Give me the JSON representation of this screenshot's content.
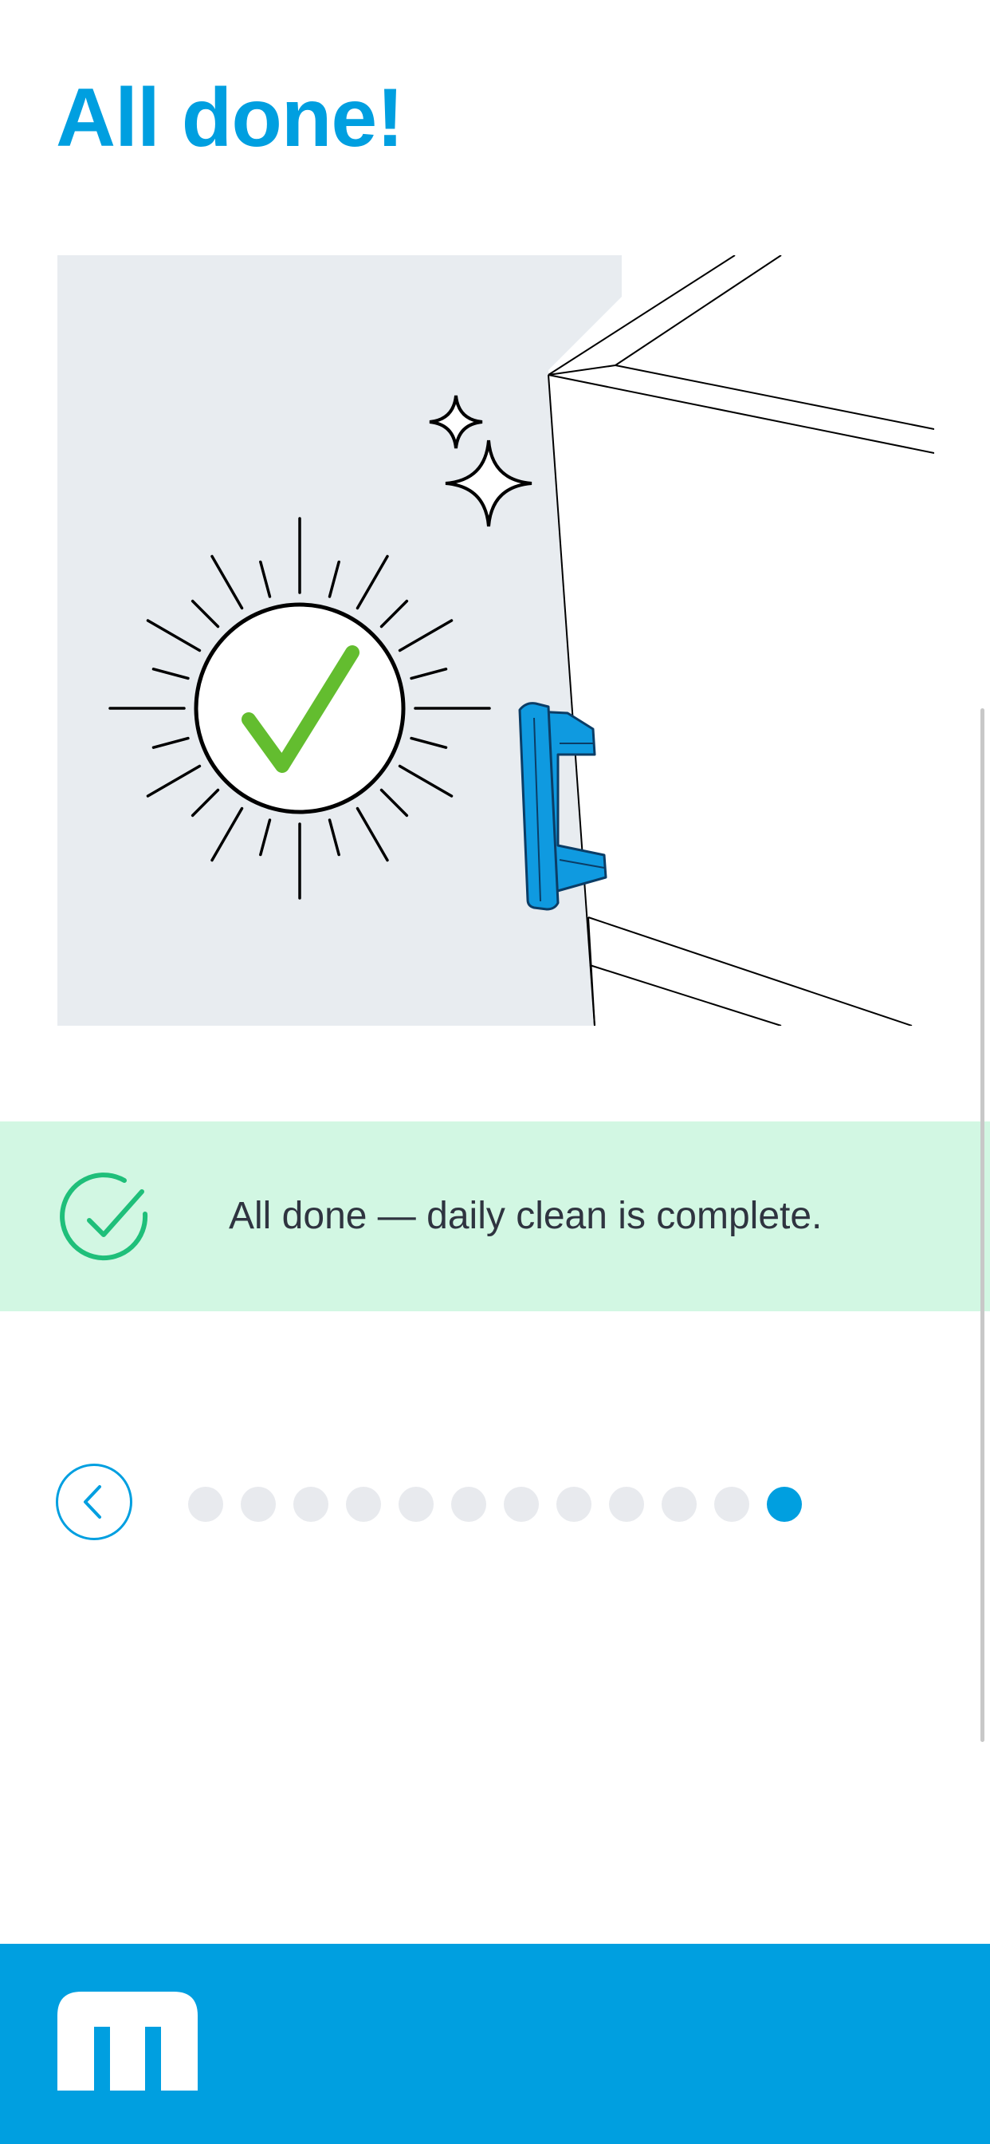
{
  "page": {
    "title": "All done!",
    "accent_color": "#009fe0"
  },
  "illustration": {
    "description_icon": "check-sun-and-door-icon",
    "check_color": "#63bd2f",
    "handle_color": "#0f9ae0",
    "background_color": "#e8ecf0"
  },
  "banner": {
    "text": "All done — daily clean is complete.",
    "icon": "check-circle-icon",
    "background_color": "#d2f7e3",
    "icon_color": "#1fbf7a"
  },
  "pager": {
    "back_icon": "chevron-left-icon",
    "total_steps": 12,
    "current_step": 12,
    "dot_color": "#e8eaee",
    "active_color": "#009fe0"
  },
  "footer": {
    "logo": "m-logo-icon",
    "background_color": "#009fe0"
  }
}
